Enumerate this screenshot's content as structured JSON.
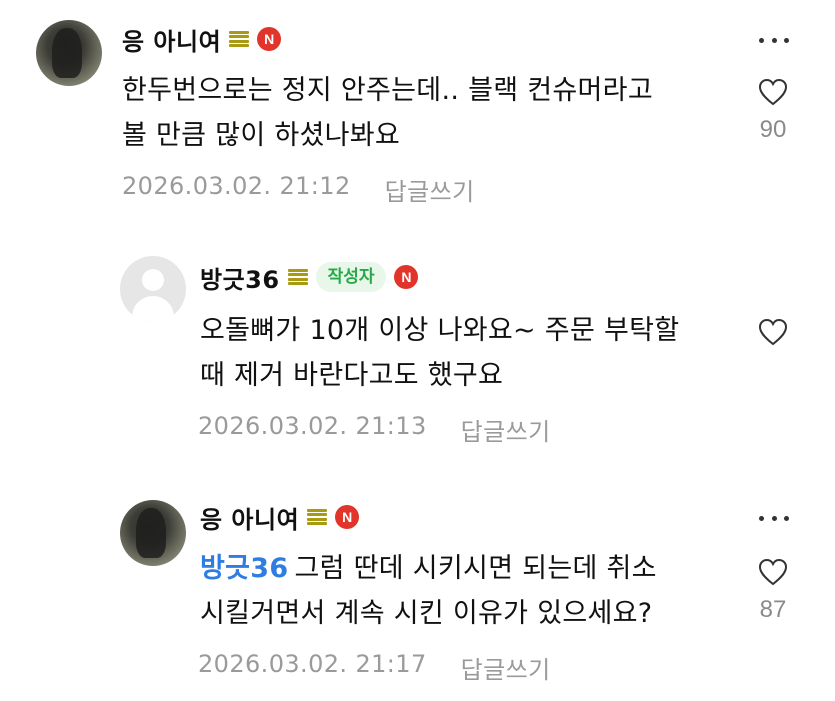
{
  "comments": [
    {
      "nickname": "응 아니여",
      "badge_n": "N",
      "author_badge": "",
      "mention": "",
      "text_line1": "한두번으로는 정지 안주는데.. 블랙 컨슈머라고",
      "text_line2": "볼 만큼 많이 하셨나봐요",
      "date": "2026.03.02. 21:12",
      "reply_label": "답글쓰기",
      "like_count": "90"
    },
    {
      "nickname": "방긋36",
      "badge_n": "N",
      "author_badge": "작성자",
      "mention": "",
      "text_line1": "오돌뼈가 10개 이상 나와요~ 주문 부탁할",
      "text_line2": "때 제거 바란다고도 했구요",
      "date": "2026.03.02. 21:13",
      "reply_label": "답글쓰기",
      "like_count": ""
    },
    {
      "nickname": "응 아니여",
      "badge_n": "N",
      "author_badge": "",
      "mention": "방긋36",
      "text_line1": "그럼 딴데 시키시면 되는데 취소",
      "text_line2": "시킬거면서 계속 시킨 이유가 있으세요?",
      "date": "2026.03.02. 21:17",
      "reply_label": "답글쓰기",
      "like_count": "87"
    }
  ],
  "icons": {
    "level": "level-bars-icon",
    "more": "more-dots-icon",
    "like": "heart-outline-icon"
  },
  "colors": {
    "mention": "#2f7de1",
    "n_badge": "#e1342a",
    "author_badge_bg": "#e8f7ea",
    "author_badge_text": "#27a94a",
    "meta_text": "#9a9a9a"
  }
}
